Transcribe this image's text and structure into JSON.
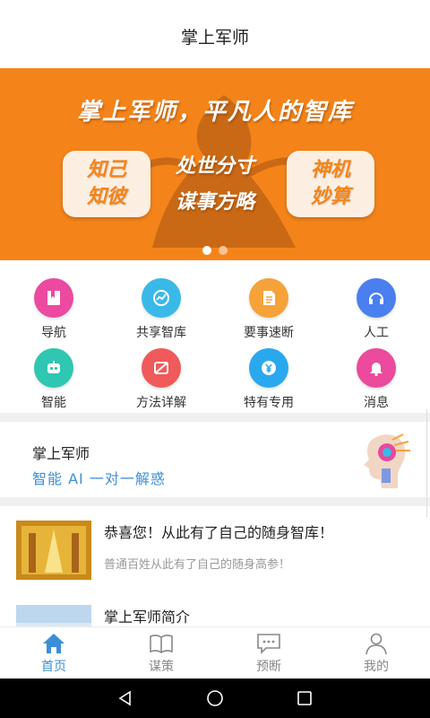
{
  "header": {
    "title": "掌上军师"
  },
  "banner": {
    "slogan": "掌上军师，平凡人的智库",
    "left_card": [
      "知己",
      "知彼"
    ],
    "middle": [
      "处世分寸",
      "谋事方略"
    ],
    "right_card": [
      "神机",
      "妙算"
    ],
    "dots": 2,
    "active_dot": 0,
    "colors": {
      "background": "#f4841a",
      "card": "#fcefe2"
    }
  },
  "grid": [
    {
      "label": "导航",
      "icon": "bookmark-icon",
      "color": "#ec4aa0"
    },
    {
      "label": "共享智库",
      "icon": "chart-icon",
      "color": "#3ab9e8"
    },
    {
      "label": "要事速断",
      "icon": "document-icon",
      "color": "#f6a23a"
    },
    {
      "label": "人工",
      "icon": "headset-icon",
      "color": "#4a7ff0"
    },
    {
      "label": "智能",
      "icon": "robot-icon",
      "color": "#2fc6b2"
    },
    {
      "label": "方法详解",
      "icon": "no-image-icon",
      "color": "#f05a5a"
    },
    {
      "label": "特有专用",
      "icon": "yen-icon",
      "color": "#2aa8ee"
    },
    {
      "label": "消息",
      "icon": "bell-icon",
      "color": "#ec4a9c"
    }
  ],
  "ai_section": {
    "title": "掌上军师",
    "subtitle": "智能 AI 一对一解惑"
  },
  "articles": [
    {
      "title": "恭喜您！从此有了自己的随身智库！",
      "desc": "普通百姓从此有了自己的随身高参！"
    },
    {
      "title": "掌上军师简介",
      "desc": ""
    }
  ],
  "bottom_nav": [
    {
      "label": "首页",
      "icon": "home-icon",
      "active": true
    },
    {
      "label": "谋策",
      "icon": "book-icon",
      "active": false
    },
    {
      "label": "预断",
      "icon": "chat-icon",
      "active": false
    },
    {
      "label": "我的",
      "icon": "user-icon",
      "active": false
    }
  ],
  "colors": {
    "accent": "#3d8ed8",
    "inactive": "#888888"
  }
}
